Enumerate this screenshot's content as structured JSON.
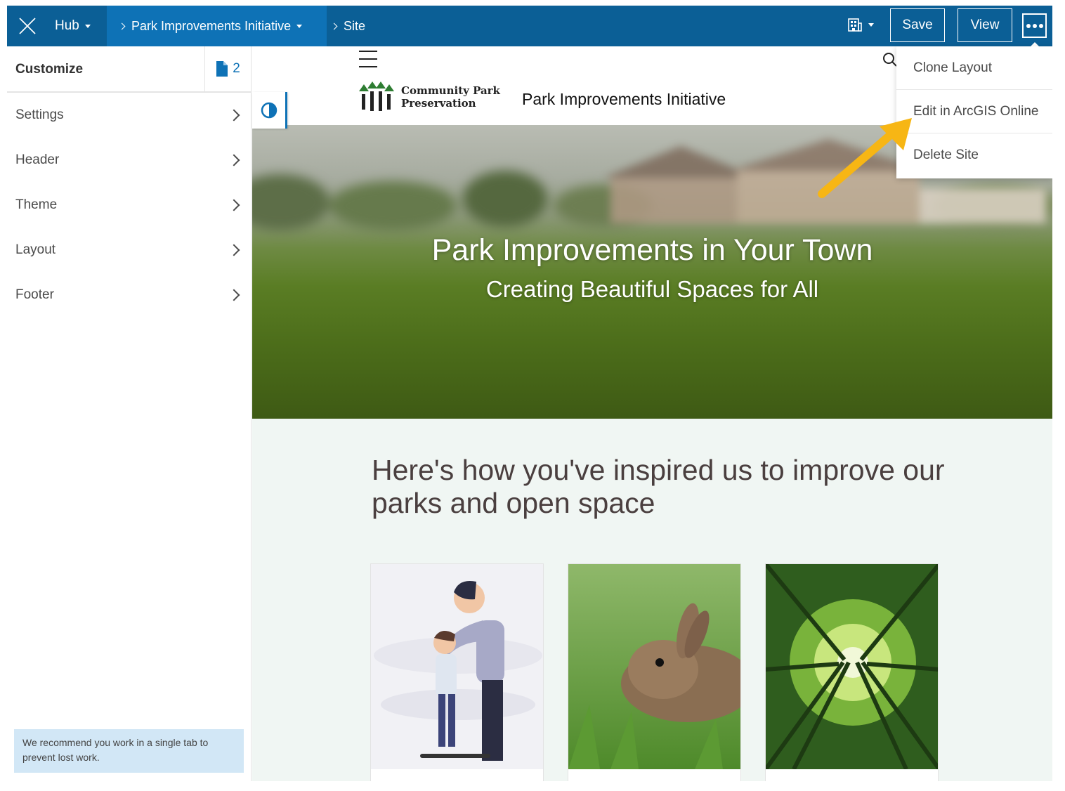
{
  "topbar": {
    "hub_label": "Hub",
    "breadcrumb_initiative": "Park Improvements Initiative",
    "breadcrumb_site": "Site",
    "save_label": "Save",
    "view_label": "View",
    "more_icon": "ellipsis-icon",
    "org_icon": "building-icon"
  },
  "sidebar": {
    "title": "Customize",
    "pages_count": "2",
    "items": [
      {
        "label": "Settings"
      },
      {
        "label": "Header"
      },
      {
        "label": "Theme"
      },
      {
        "label": "Layout"
      },
      {
        "label": "Footer"
      }
    ],
    "notice": "We recommend you work in a single tab to prevent lost work."
  },
  "site": {
    "logo_line1": "Community Park",
    "logo_line2": "Preservation",
    "title": "Park Improvements Initiative",
    "hero_title": "Park Improvements in Your Town",
    "hero_subtitle": "Creating Beautiful Spaces for All",
    "section_heading": "Here's how you've inspired us to improve our parks and open space"
  },
  "dropdown": {
    "items": [
      {
        "label": "Clone Layout"
      },
      {
        "label": "Edit in ArcGIS Online"
      },
      {
        "label": "Delete Site"
      }
    ]
  },
  "colors": {
    "topbar": "#0b5f96",
    "topbar_active": "#0e72b6",
    "accent": "#0e72b6",
    "callout_arrow": "#f7b614",
    "notice_bg": "#d2e7f6"
  }
}
